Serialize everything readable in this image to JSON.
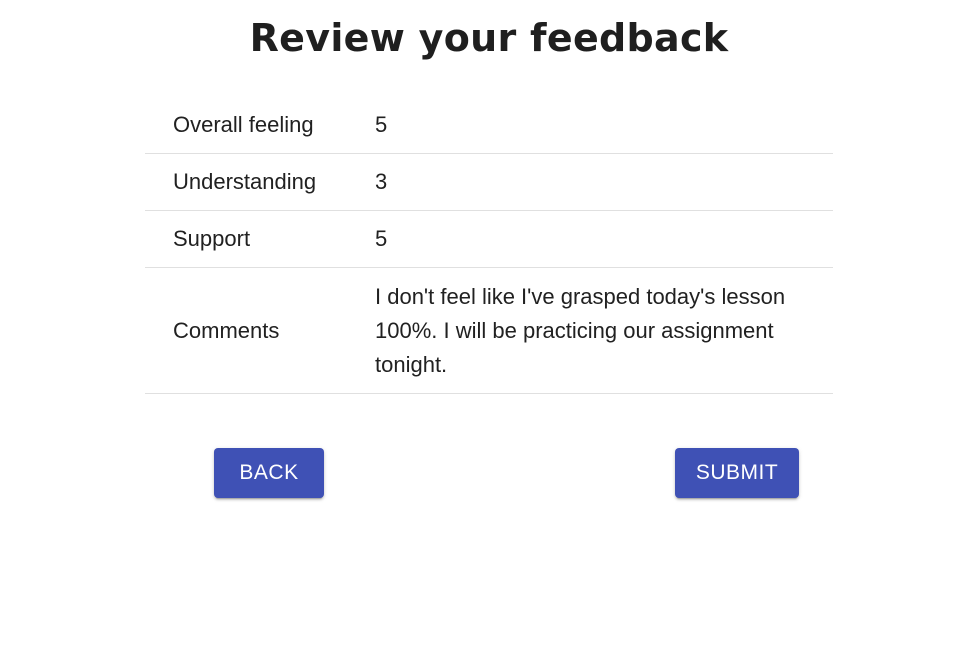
{
  "header": {
    "title": "Review your feedback"
  },
  "review": {
    "rows": [
      {
        "label": "Overall feeling",
        "value": "5"
      },
      {
        "label": "Understanding",
        "value": "3"
      },
      {
        "label": "Support",
        "value": "5"
      },
      {
        "label": "Comments",
        "value": "I don't feel like I've grasped today's lesson 100%. I will be practicing our assignment tonight."
      }
    ]
  },
  "actions": {
    "back_label": "BACK",
    "submit_label": "SUBMIT"
  },
  "colors": {
    "button_primary": "#3f51b5",
    "button_text": "#ffffff",
    "divider": "#e0e0e0",
    "text": "#212121"
  }
}
